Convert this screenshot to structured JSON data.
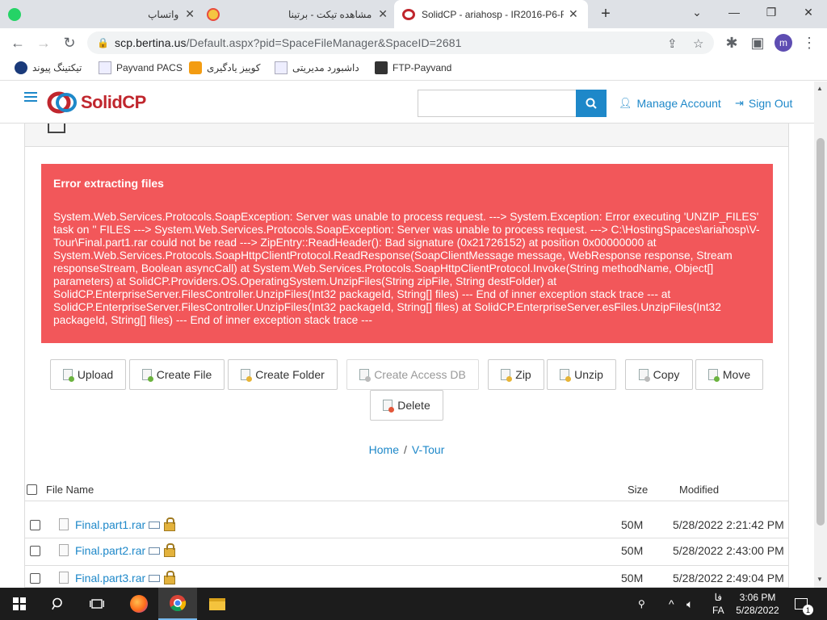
{
  "browser": {
    "tabs": [
      {
        "title": "واتساپ",
        "active": false
      },
      {
        "title": "مشاهده تیکت - برتینا",
        "active": false
      },
      {
        "title": "SolidCP - ariahosp - IR2016-P6-F",
        "active": true
      }
    ],
    "new_tab": "+",
    "url_host": "scp.bertina.us",
    "url_path": "/Default.aspx?pid=SpaceFileManager&SpaceID=2681",
    "profile_initial": "m",
    "bookmarks": [
      {
        "label": "تیکتینگ پیوند"
      },
      {
        "label": "Payvand PACS"
      },
      {
        "label": "کوییز یادگیری"
      },
      {
        "label": "داشبورد مدیریتی"
      },
      {
        "label": "FTP-Payvand"
      }
    ]
  },
  "site": {
    "logo_text": "SolidCP",
    "search_placeholder": "",
    "manage_account": "Manage Account",
    "sign_out": "Sign Out"
  },
  "alert": {
    "title": "Error extracting files",
    "message": "System.Web.Services.Protocols.SoapException: Server was unable to process request. ---> System.Exception: Error executing 'UNZIP_FILES' task on '' FILES ---> System.Web.Services.Protocols.SoapException: Server was unable to process request. ---> C:\\HostingSpaces\\ariahosp\\V-Tour\\Final.part1.rar could not be read ---> ZipEntry::ReadHeader(): Bad signature (0x21726152) at position 0x00000000 at System.Web.Services.Protocols.SoapHttpClientProtocol.ReadResponse(SoapClientMessage message, WebResponse response, Stream responseStream, Boolean asyncCall) at System.Web.Services.Protocols.SoapHttpClientProtocol.Invoke(String methodName, Object[] parameters) at SolidCP.Providers.OS.OperatingSystem.UnzipFiles(String zipFile, String destFolder) at SolidCP.EnterpriseServer.FilesController.UnzipFiles(Int32 packageId, String[] files) --- End of inner exception stack trace --- at SolidCP.EnterpriseServer.FilesController.UnzipFiles(Int32 packageId, String[] files) at SolidCP.EnterpriseServer.esFiles.UnzipFiles(Int32 packageId, String[] files) --- End of inner exception stack trace ---"
  },
  "toolbar": {
    "upload": "Upload",
    "create_file": "Create File",
    "create_folder": "Create Folder",
    "create_access_db": "Create Access DB",
    "zip": "Zip",
    "unzip": "Unzip",
    "copy": "Copy",
    "move": "Move",
    "delete": "Delete"
  },
  "breadcrumb": {
    "home": "Home",
    "separator": "/",
    "current": "V-Tour"
  },
  "table": {
    "col_name": "File Name",
    "col_size": "Size",
    "col_modified": "Modified",
    "rows": [
      {
        "name": "Final.part1.rar",
        "size": "50M",
        "modified": "5/28/2022 2:21:42 PM"
      },
      {
        "name": "Final.part2.rar",
        "size": "50M",
        "modified": "5/28/2022 2:43:00 PM"
      },
      {
        "name": "Final.part3.rar",
        "size": "50M",
        "modified": "5/28/2022 2:49:04 PM"
      }
    ]
  },
  "taskbar": {
    "lang_short": "فا",
    "lang": "FA",
    "time": "3:06 PM",
    "date": "5/28/2022",
    "notif_count": "1"
  },
  "colors": {
    "accent": "#1e88c9",
    "alert": "#f2575a",
    "logo_red": "#c0262d"
  }
}
